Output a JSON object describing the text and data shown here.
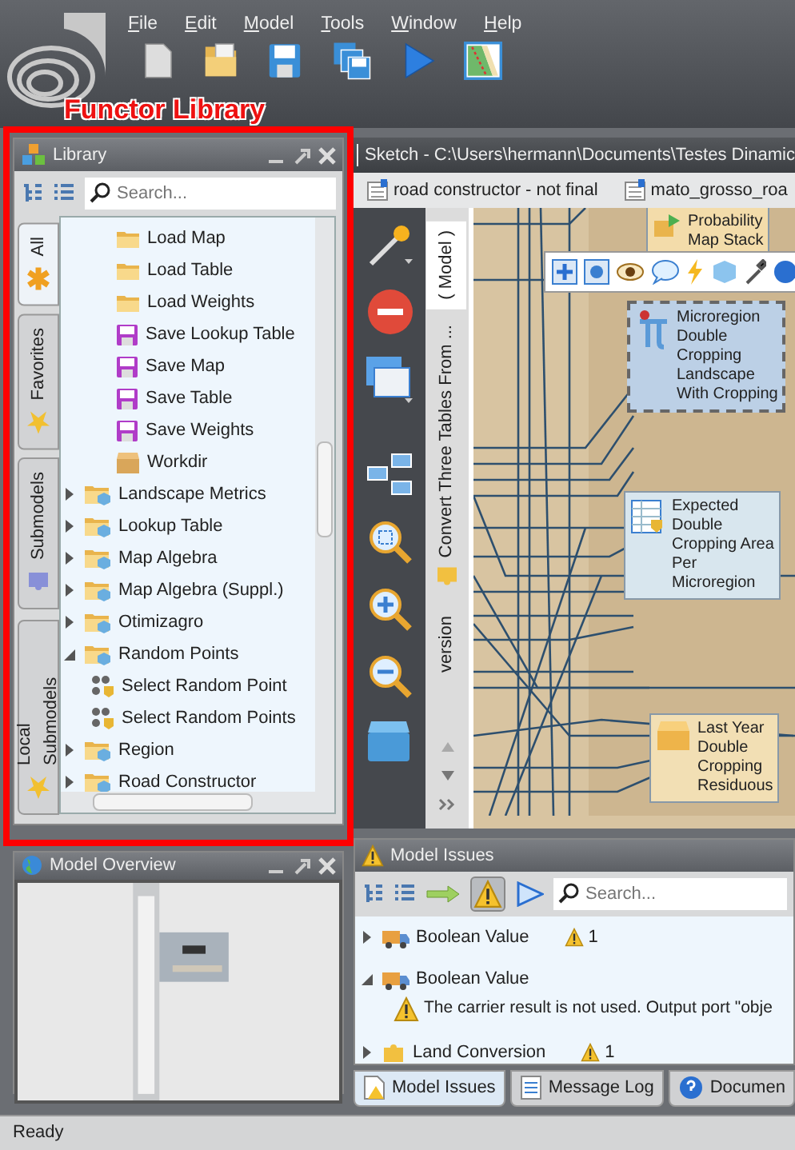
{
  "menu": [
    "File",
    "Edit",
    "Model",
    "Tools",
    "Window",
    "Help"
  ],
  "annotation": {
    "label": "Functor Library"
  },
  "library": {
    "title": "Library",
    "search": {
      "placeholder": "Search..."
    },
    "tabs": [
      {
        "label": "All",
        "selected": true,
        "kind": "all"
      },
      {
        "label": "Favorites",
        "selected": false,
        "kind": "star"
      },
      {
        "label": "Submodels",
        "selected": false,
        "kind": "puzzle"
      },
      {
        "label": "Local Submodels",
        "selected": false,
        "kind": "star"
      }
    ],
    "tree": [
      {
        "children": [
          {
            "label": "Load Map",
            "kind": "load"
          },
          {
            "label": "Load Table",
            "kind": "load"
          },
          {
            "label": "Load Weights",
            "kind": "load"
          },
          {
            "label": "Save Lookup Table",
            "kind": "save"
          },
          {
            "label": "Save Map",
            "kind": "save"
          },
          {
            "label": "Save Table",
            "kind": "save"
          },
          {
            "label": "Save Weights",
            "kind": "save"
          },
          {
            "label": "Workdir",
            "kind": "box"
          }
        ]
      },
      {
        "label": "Landscape Metrics",
        "kind": "group",
        "expanded": false
      },
      {
        "label": "Lookup Table",
        "kind": "group",
        "expanded": false
      },
      {
        "label": "Map Algebra",
        "kind": "group",
        "expanded": false
      },
      {
        "label": "Map Algebra (Suppl.)",
        "kind": "group",
        "expanded": false
      },
      {
        "label": "Otimizagro",
        "kind": "group",
        "expanded": false
      },
      {
        "label": "Random Points",
        "kind": "group",
        "expanded": true,
        "children": [
          {
            "label": "Select Random Point",
            "kind": "points"
          },
          {
            "label": "Select Random Points",
            "kind": "points"
          }
        ]
      },
      {
        "label": "Region",
        "kind": "group",
        "expanded": false
      },
      {
        "label": "Road Constructor",
        "kind": "group",
        "expanded": false
      }
    ]
  },
  "overview": {
    "title": "Model Overview"
  },
  "sketch": {
    "title": "Sketch - C:\\Users\\hermann\\Documents\\Testes Dinamic",
    "documents": [
      {
        "label": "road constructor - not final"
      },
      {
        "label": "mato_grosso_roa"
      }
    ],
    "side_tabs": [
      {
        "label": "( Model )",
        "selected": true
      },
      {
        "label": "Convert Three Tables From ...",
        "selected": false
      },
      {
        "label": "version",
        "selected": false
      }
    ],
    "nodes": [
      {
        "kind": "stack",
        "lines": [
          "Probability",
          "Map Stack"
        ]
      },
      {
        "kind": "calc",
        "lines": [
          "Microregion",
          "Double",
          "Cropping",
          "Landscape",
          "With Cropping"
        ]
      },
      {
        "kind": "table",
        "lines": [
          "Expected",
          "Double",
          "Cropping Area",
          "Per",
          "Microregion"
        ]
      },
      {
        "kind": "box",
        "lines": [
          "Last Year",
          "Double",
          "Cropping",
          "Residuous"
        ]
      }
    ]
  },
  "issues": {
    "title": "Model Issues",
    "warnings_filter_on": true,
    "search": {
      "placeholder": "Search..."
    },
    "rows": [
      {
        "label": "Boolean Value",
        "count": "1",
        "expanded": false,
        "kind": "carrier"
      },
      {
        "label": "Boolean Value",
        "expanded": true,
        "kind": "carrier",
        "children": [
          {
            "message": "The carrier result is not used. Output port \"obje"
          }
        ]
      },
      {
        "label": "Land Conversion",
        "count": "1",
        "expanded": false,
        "kind": "puzzle"
      }
    ],
    "tabs": [
      {
        "label": "Model Issues",
        "selected": true
      },
      {
        "label": "Message Log",
        "selected": false
      },
      {
        "label": "Documen",
        "selected": false
      }
    ]
  },
  "status_bar": "Ready"
}
